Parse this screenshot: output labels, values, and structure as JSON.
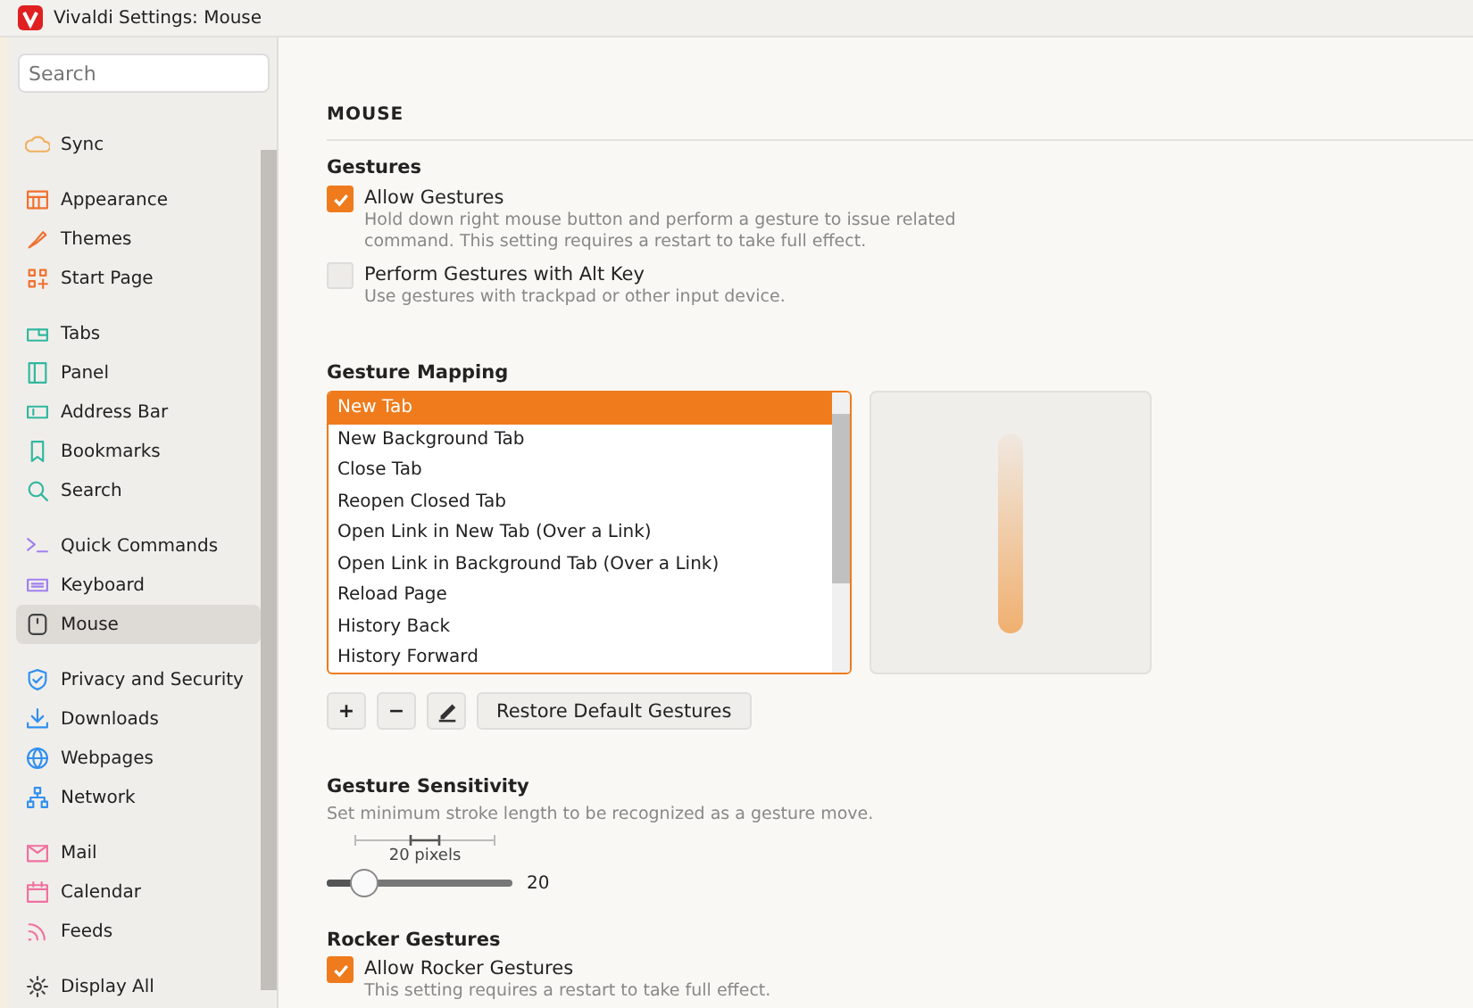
{
  "window": {
    "title": "Vivaldi Settings: Mouse"
  },
  "sidebar": {
    "search": {
      "placeholder": "Search"
    },
    "groups": [
      {
        "items": [
          {
            "label": "Sync",
            "selected": false,
            "color": "#f0b060"
          }
        ]
      },
      {
        "items": [
          {
            "label": "Appearance",
            "selected": false,
            "color": "#f07030"
          },
          {
            "label": "Themes",
            "selected": false,
            "color": "#f07030"
          },
          {
            "label": "Start Page",
            "selected": false,
            "color": "#f07030"
          }
        ]
      },
      {
        "items": [
          {
            "label": "Tabs",
            "selected": false,
            "color": "#30b8a0"
          },
          {
            "label": "Panel",
            "selected": false,
            "color": "#30b8a0"
          },
          {
            "label": "Address Bar",
            "selected": false,
            "color": "#30b8a0"
          },
          {
            "label": "Bookmarks",
            "selected": false,
            "color": "#30b8a0"
          },
          {
            "label": "Search",
            "selected": false,
            "color": "#30b8a0"
          }
        ]
      },
      {
        "items": [
          {
            "label": "Quick Commands",
            "selected": false,
            "color": "#a080f0"
          },
          {
            "label": "Keyboard",
            "selected": false,
            "color": "#a080f0"
          },
          {
            "label": "Mouse",
            "selected": true,
            "color": "#404040"
          }
        ]
      },
      {
        "items": [
          {
            "label": "Privacy and Security",
            "selected": false,
            "color": "#3090f0"
          },
          {
            "label": "Downloads",
            "selected": false,
            "color": "#3090f0"
          },
          {
            "label": "Webpages",
            "selected": false,
            "color": "#3090f0"
          },
          {
            "label": "Network",
            "selected": false,
            "color": "#3090f0"
          }
        ]
      },
      {
        "items": [
          {
            "label": "Mail",
            "selected": false,
            "color": "#f070a0"
          },
          {
            "label": "Calendar",
            "selected": false,
            "color": "#f070a0"
          },
          {
            "label": "Feeds",
            "selected": false,
            "color": "#f070a0"
          }
        ]
      },
      {
        "items": [
          {
            "label": "Display All",
            "selected": false,
            "color": "#404040"
          }
        ]
      }
    ]
  },
  "main": {
    "heading": "MOUSE",
    "gestures": {
      "title": "Gestures",
      "options": [
        {
          "label": "Allow Gestures",
          "description": "Hold down right mouse button and perform a gesture to issue related command. This setting requires a restart to take full effect.",
          "checked": true
        },
        {
          "label": "Perform Gestures with Alt Key",
          "description": "Use gestures with trackpad or other input device.",
          "checked": false
        }
      ]
    },
    "mapping": {
      "title": "Gesture Mapping",
      "rows": [
        {
          "label": "New Tab",
          "selected": true
        },
        {
          "label": "New Background Tab",
          "selected": false
        },
        {
          "label": "Close Tab",
          "selected": false
        },
        {
          "label": "Reopen Closed Tab",
          "selected": false
        },
        {
          "label": "Open Link in New Tab (Over a Link)",
          "selected": false
        },
        {
          "label": "Open Link in Background Tab (Over a Link)",
          "selected": false
        },
        {
          "label": "Reload Page",
          "selected": false
        },
        {
          "label": "History Back",
          "selected": false
        },
        {
          "label": "History Forward",
          "selected": false
        }
      ],
      "buttons": [
        "+",
        "−",
        "Restore Default Gestures"
      ]
    },
    "sensitivity": {
      "title": "Gesture Sensitivity",
      "description": "Set minimum stroke length to be recognized as a gesture move.",
      "scale_label": "20 pixels",
      "level": 0.2,
      "value": "20"
    },
    "rocker": {
      "title": "Rocker Gestures",
      "options": [
        {
          "label": "Allow Rocker Gestures",
          "description": "This setting requires a restart to take full effect.",
          "checked": true
        }
      ]
    }
  }
}
